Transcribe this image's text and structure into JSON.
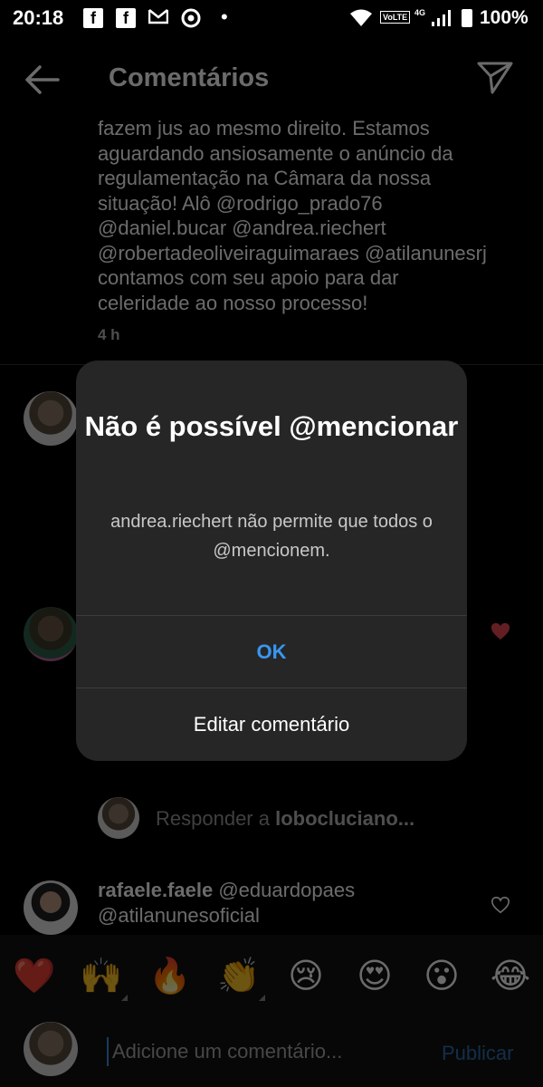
{
  "status_bar": {
    "time": "20:18",
    "battery": "100%",
    "network_badge": "VoLTE",
    "network_type": "4G"
  },
  "header": {
    "title": "Comentários"
  },
  "comment": {
    "text": "fazem jus ao mesmo direito. Estamos aguardando ansiosamente o anúncio da regulamentação na Câmara da nossa situação! Alô @rodrigo_prado76 @daniel.bucar @andrea.riechert @robertadeoliveiraguimaraes @atilanunesrj contamos com seu apoio para dar celeridade ao nosso processo!",
    "time": "4 h"
  },
  "reply": {
    "prefix": "Responder a ",
    "user": "lobocluciano..."
  },
  "comment2": {
    "user": "rafaele.faele",
    "text": " @eduardopaes @atilanunesoficial"
  },
  "emojis": [
    "❤️",
    "🙌",
    "🔥",
    "👏",
    "😢",
    "😍",
    "😮",
    "😂"
  ],
  "input": {
    "placeholder": "Adicione um comentário...",
    "publish_label": "Publicar"
  },
  "dialog": {
    "title": "Não é possível @mencionar",
    "message": "andrea.riechert não permite que todos o @mencionem.",
    "ok_label": "OK",
    "edit_label": "Editar comentário"
  },
  "colors": {
    "accent": "#3897f0",
    "heart": "#ed4956",
    "dialog_bg": "#262626"
  }
}
